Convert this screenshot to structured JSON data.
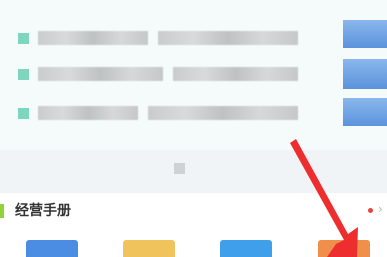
{
  "section": {
    "title": "经营手册"
  },
  "colors": {
    "accent_bar": "#8ed33a",
    "notification_dot": "#e6453d",
    "annotation_arrow": "#ee2e2e"
  },
  "icons": {
    "row_marker": "square",
    "more": "chevron-right-icon"
  }
}
